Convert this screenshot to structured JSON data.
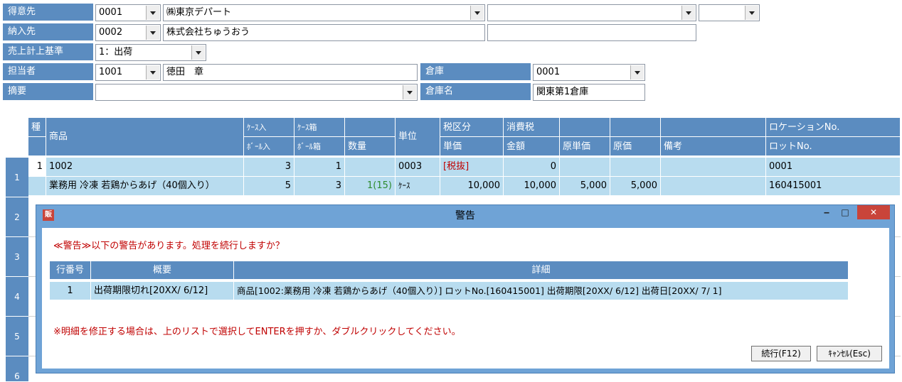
{
  "header": {
    "customer_label": "得意先",
    "customer_code": "0001",
    "customer_name": "㈱東京デパート",
    "delivery_label": "納入先",
    "delivery_code": "0002",
    "delivery_name": "株式会社ちゅうおう",
    "sales_basis_label": "売上計上基準",
    "sales_basis_value": "1：出荷",
    "staff_label": "担当者",
    "staff_code": "1001",
    "staff_name": "徳田　章",
    "summary_label": "摘要",
    "summary_value": "",
    "warehouse_label": "倉庫",
    "warehouse_code": "0001",
    "warehouse_name_label": "倉庫名",
    "warehouse_name": "関東第1倉庫"
  },
  "grid": {
    "col_kind": "種",
    "col_product": "商品",
    "col_case_qty": "ｹｰｽ入",
    "col_ball_qty": "ﾎﾞｰﾙ入",
    "col_case_box": "ｹｰｽ箱",
    "col_ball_box": "ﾎﾞｰﾙ箱",
    "col_quantity": "数量",
    "col_unit": "単位",
    "col_tax_class": "税区分",
    "col_unit_price": "単価",
    "col_consumption_tax": "消費税",
    "col_amount": "金額",
    "col_cost_unit_price": "原単価",
    "col_cost": "原価",
    "col_remarks": "備考",
    "col_location": "ロケーションNo.",
    "col_lot": "ロットNo.",
    "row_numbers": [
      "1",
      "2",
      "3",
      "4",
      "5",
      "6"
    ],
    "row1": {
      "kind": "1",
      "product_code": "1002",
      "product_name": "業務用 冷凍 若鶏からあげ（40個入り）",
      "case_qty": "3",
      "ball_qty": "5",
      "case_box": "1",
      "ball_box": "3",
      "quantity": "1(15)",
      "unit_code": "0003",
      "unit_name": "ｹｰｽ",
      "tax_class": "[税抜]",
      "unit_price": "10,000",
      "consumption_tax": "0",
      "amount": "10,000",
      "cost_unit_price": "5,000",
      "cost": "5,000",
      "remarks": "",
      "location": "0001",
      "lot": "160415001"
    }
  },
  "dialog": {
    "app_icon": "販",
    "title": "警告",
    "message": "≪警告≫以下の警告があります。処理を続行しますか？",
    "col_row_no": "行番号",
    "col_overview": "概要",
    "col_detail": "詳細",
    "row_no": "1",
    "overview": "出荷期限切れ[20XX/ 6/12]",
    "detail": "商品[1002:業務用 冷凍 若鶏からあげ（40個入り）] ロットNo.[160415001] 出荷期限[20XX/ 6/12] 出荷日[20XX/ 7/ 1]",
    "note": "※明細を修正する場合は、上のリストで選択してENTERを押すか、ダブルクリックしてください。",
    "continue_button": "続行(F12)",
    "cancel_button": "ｷｬﾝｾﾙ(Esc)",
    "minimize": "‒",
    "maximize": "□",
    "close": "✕"
  },
  "colors": {
    "header_blue": "#5b8cc0",
    "row_highlight": "#b8dcef",
    "warning_red": "#c00000",
    "quantity_green": "#2e8b2e",
    "close_button": "#c9443a"
  }
}
